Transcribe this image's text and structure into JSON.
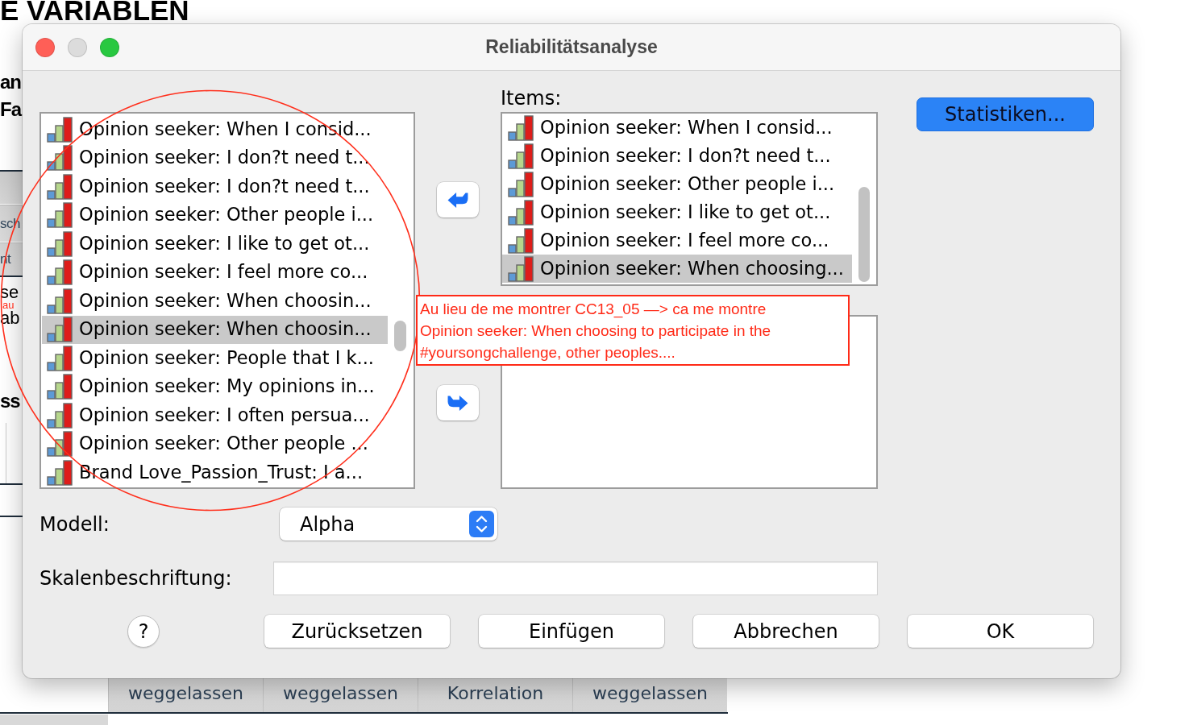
{
  "background_document": {
    "heading": "E VARIABLEN",
    "side_texts": [
      {
        "text": "an",
        "kind": "heading"
      },
      {
        "text": "Fa",
        "kind": "heading"
      },
      {
        "text": "sch",
        "kind": "cell"
      },
      {
        "text": "nt",
        "kind": "cell"
      },
      {
        "text": "se",
        "kind": "body"
      },
      {
        "text": "ab",
        "kind": "body"
      },
      {
        "text": "ss",
        "kind": "heading"
      }
    ],
    "table_headers": [
      "weggelassen",
      "weggelassen",
      "Korrelation",
      "weggelassen"
    ]
  },
  "dialog": {
    "title": "Reliabilitätsanalyse",
    "minimize_disabled": true,
    "source_list": {
      "items": [
        {
          "label": "Opinion seeker: When I consid...",
          "selected": false
        },
        {
          "label": "Opinion seeker: I don?t need t...",
          "selected": false
        },
        {
          "label": "Opinion seeker: I don?t need t...",
          "selected": false
        },
        {
          "label": "Opinion seeker: Other people i...",
          "selected": false
        },
        {
          "label": "Opinion seeker: I like to get ot...",
          "selected": false
        },
        {
          "label": "Opinion seeker: I feel more co...",
          "selected": false
        },
        {
          "label": "Opinion seeker: When choosin...",
          "selected": false
        },
        {
          "label": "Opinion seeker: When choosin...",
          "selected": true
        },
        {
          "label": "Opinion seeker: People that I k...",
          "selected": false
        },
        {
          "label": "Opinion seeker: My opinions in...",
          "selected": false
        },
        {
          "label": "Opinion seeker: I often persua...",
          "selected": false
        },
        {
          "label": "Opinion seeker: Other people ...",
          "selected": false
        },
        {
          "label": "Brand Love_Passion_Trust: I a...",
          "selected": false
        }
      ]
    },
    "items_label": "Items:",
    "items_list": {
      "items": [
        {
          "label": "Opinion seeker: When I consid...",
          "selected": false
        },
        {
          "label": "Opinion seeker: I don?t need t...",
          "selected": false
        },
        {
          "label": "Opinion seeker: Other people i...",
          "selected": false
        },
        {
          "label": "Opinion seeker: I like to get ot...",
          "selected": false
        },
        {
          "label": "Opinion seeker: I feel more co...",
          "selected": false
        },
        {
          "label": "Opinion seeker: When choosing...",
          "selected": true
        }
      ]
    },
    "statistics_button": "Statistiken...",
    "model": {
      "label": "Modell:",
      "value": "Alpha"
    },
    "scale_label": {
      "label": "Skalenbeschriftung:"
    },
    "help_button": "?",
    "buttons": [
      "Zurücksetzen",
      "Einfügen",
      "Abbrechen",
      "OK"
    ]
  },
  "annotations": {
    "margin_note": "au",
    "note_lines": [
      "Au lieu de me montrer CC13_05 —> ca me montre",
      "Opinion seeker: When choosing to participate in the",
      "#yoursongchallenge, other peoples...."
    ]
  }
}
